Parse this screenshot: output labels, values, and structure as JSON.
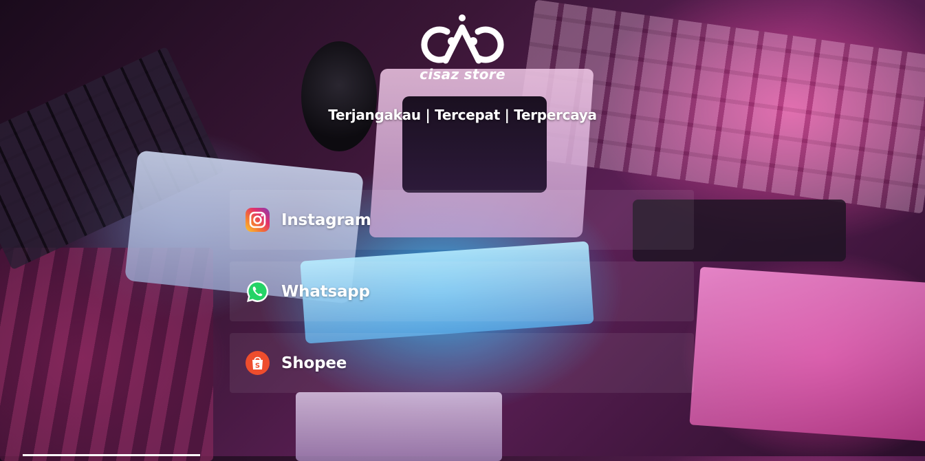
{
  "brand": {
    "name": "cisaz store",
    "logo_icon": "cisaz-logo-icon"
  },
  "tagline": "Terjangakau | Tercepat | Terpercaya",
  "links": [
    {
      "label": "Instagram",
      "icon": "instagram-icon",
      "color": "#E1306C"
    },
    {
      "label": "Whatsapp",
      "icon": "whatsapp-icon",
      "color": "#25D366"
    },
    {
      "label": "Shopee",
      "icon": "shopee-icon",
      "color": "#EE4D2D"
    }
  ],
  "theme": {
    "text_color": "#FFFFFF",
    "card_background": "rgba(255,255,255,0.07)"
  }
}
